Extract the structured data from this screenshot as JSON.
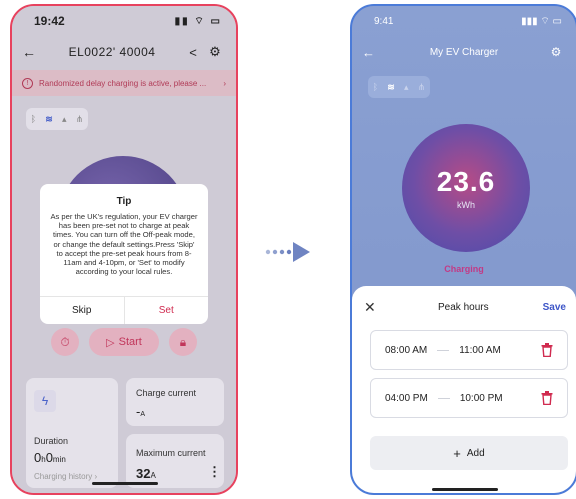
{
  "left_phone": {
    "status_time": "19:42",
    "status_icons": "▮▮ ⌔ ▭",
    "header_title": "EL0022'   40004",
    "banner_text": "Randomized delay charging is active, please ...",
    "start_label": "Start",
    "cards": {
      "duration_label": "Duration",
      "duration_hours": "0",
      "duration_hours_unit": "h",
      "duration_minutes": "0",
      "duration_minutes_unit": "min",
      "history_label": "Charging history",
      "charge_current_label": "Charge current",
      "charge_current_value": "-",
      "charge_current_unit": "A",
      "max_current_label": "Maximum current",
      "max_current_value": "32",
      "max_current_unit": "A"
    },
    "dialog": {
      "title": "Tip",
      "body": "As per the UK's regulation, your EV charger has been pre-set not to charge at peak times. You can turn off the Off-peak mode, or change the default settings.Press 'Skip' to accept the pre-set peak hours from 8-11am and 4-10pm, or 'Set' to modify according to your local rules.",
      "skip_label": "Skip",
      "set_label": "Set"
    }
  },
  "right_phone": {
    "status_time": "9:41",
    "status_icons": "▮▮▮ ⌔ ▭",
    "header_title": "My EV Charger",
    "energy_value": "23.6",
    "energy_unit": "kWh",
    "state_label": "Charging",
    "sheet": {
      "title": "Peak hours",
      "save_label": "Save",
      "periods": [
        {
          "start": "08:00 AM",
          "end": "11:00 AM"
        },
        {
          "start": "04:00 PM",
          "end": "10:00 PM"
        }
      ],
      "add_label": "Add"
    }
  },
  "colors": {
    "accent_red": "#d02a4f",
    "accent_blue": "#3d55c7",
    "left_border": "#e7425e",
    "right_border": "#4b7bd8"
  }
}
